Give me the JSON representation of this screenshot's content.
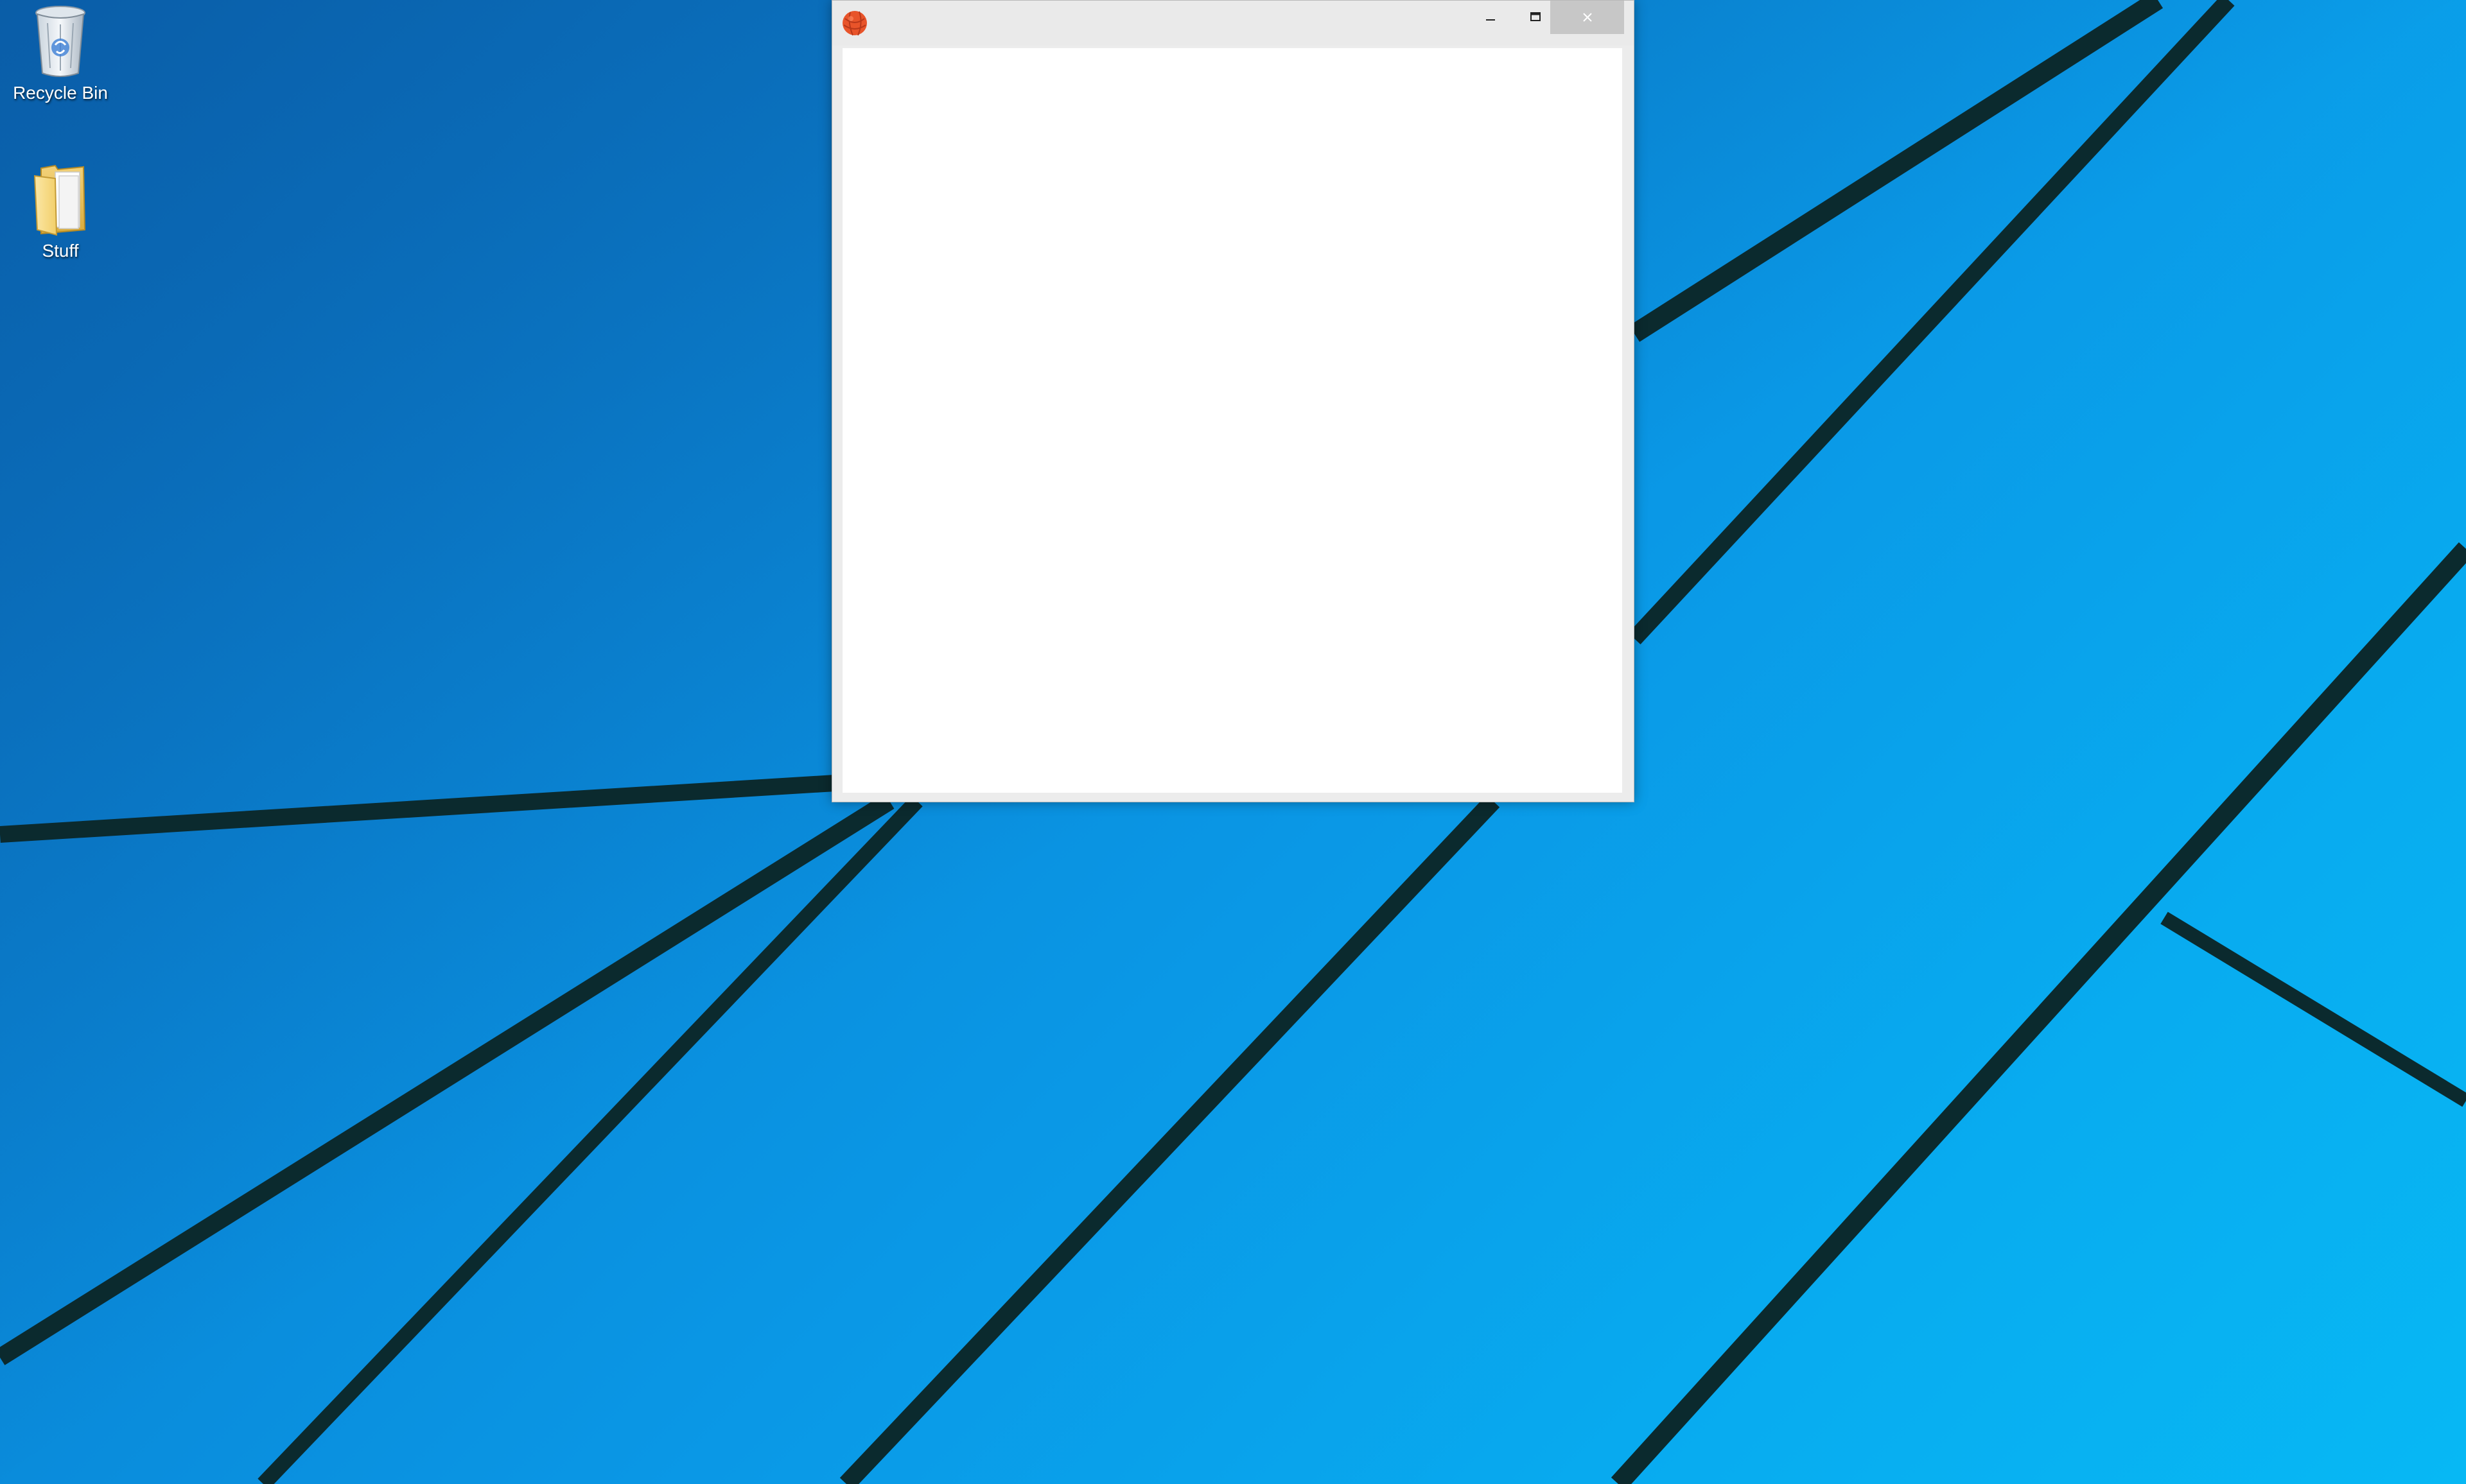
{
  "desktop": {
    "icons": [
      {
        "label": "Recycle Bin",
        "icon": "recycle-bin-icon"
      },
      {
        "label": "Stuff",
        "icon": "folder-icon"
      }
    ]
  },
  "window": {
    "title": "",
    "app_icon": "app-ball-icon",
    "controls": {
      "minimize": "minimize-icon",
      "maximize": "maximize-icon",
      "close": "close-icon"
    }
  },
  "colors": {
    "wallpaper_blue": "#0a98e6",
    "window_frame": "#ececec",
    "close_button_bg": "#c7c7c7",
    "app_icon": "#e8542a"
  }
}
